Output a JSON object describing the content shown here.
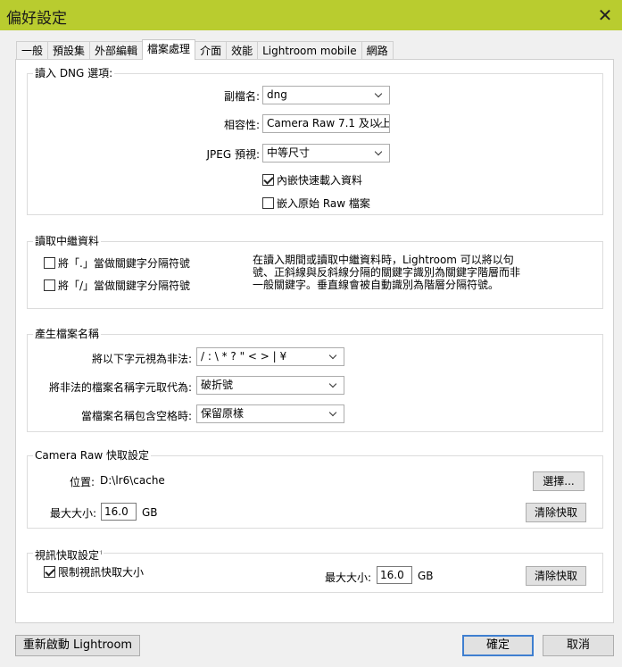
{
  "window": {
    "title": "偏好設定",
    "close_glyph": "✕"
  },
  "tabs": [
    "一般",
    "預設集",
    "外部編輯",
    "檔案處理",
    "介面",
    "效能",
    "Lightroom mobile",
    "網路"
  ],
  "dng": {
    "legend": "讀入 DNG 選項:",
    "ext_label": "副檔名:",
    "ext_value": "dng",
    "compat_label": "相容性:",
    "compat_value": "Camera Raw 7.1 及以上",
    "jpeg_label": "JPEG 預視:",
    "jpeg_value": "中等尺寸",
    "embed_fast": {
      "label": "內嵌快速載入資料",
      "checked": true
    },
    "embed_raw": {
      "label": "嵌入原始 Raw 檔案",
      "checked": false
    }
  },
  "metadata": {
    "legend": "讀取中繼資料",
    "dot_label": "將「.」當做關鍵字分隔符號",
    "slash_label": "將「/」當做關鍵字分隔符號",
    "description_lines": [
      "在讀入期間或讀取中繼資料時，Lightroom 可以將以句",
      "號、正斜線與反斜線分隔的關鍵字識別為關鍵字階層而非",
      "一般關鍵字。垂直線會被自動識別為階層分隔符號。"
    ]
  },
  "filenames": {
    "legend": "產生檔案名稱",
    "illegal_label": "將以下字元視為非法:",
    "illegal_value": "/ : \\ * ? \" < > | ¥",
    "replace_label": "將非法的檔案名稱字元取代為:",
    "replace_value": "破折號",
    "space_label": "當檔案名稱包含空格時:",
    "space_value": "保留原樣"
  },
  "camera_raw_cache": {
    "legend": "Camera Raw 快取設定",
    "location_label": "位置:",
    "location_value": "D:\\lr6\\cache",
    "choose_button": "選擇...",
    "max_size_label": "最大大小:",
    "max_size_value": "16.0",
    "max_size_unit": "GB",
    "purge_button": "清除快取"
  },
  "video_cache": {
    "legend": "視訊快取設定",
    "legend_mark": "꜉",
    "limit_label": "限制視訊快取大小",
    "limit_checked": true,
    "max_size_label": "最大大小:",
    "max_size_value": "16.0",
    "max_size_unit": "GB",
    "purge_button": "清除快取"
  },
  "footer": {
    "restart_button": "重新啟動 Lightroom",
    "ok_button": "確定",
    "cancel_button": "取消"
  }
}
